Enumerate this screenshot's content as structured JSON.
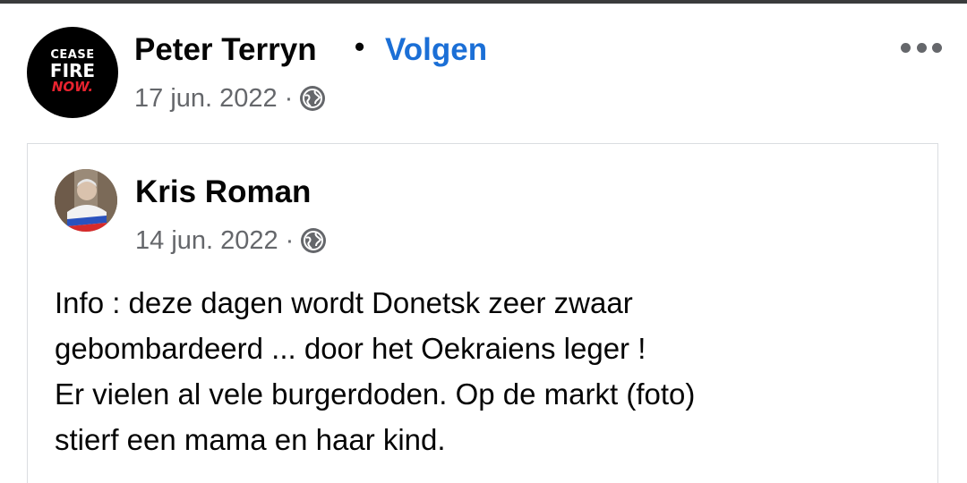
{
  "post": {
    "author": "Peter Terryn",
    "separator": "•",
    "follow_label": "Volgen",
    "date": "17 jun. 2022",
    "meta_separator": "·",
    "privacy_icon": "globe-icon",
    "menu_icon": "more-options-icon",
    "avatar": {
      "line1": "CEASE",
      "line2": "FIRE",
      "line3": "NOW."
    }
  },
  "shared": {
    "author": "Kris Roman",
    "date": "14 jun. 2022",
    "meta_separator": "·",
    "privacy_icon": "globe-icon",
    "text_lines": [
      "Info : deze dagen wordt Donetsk zeer zwaar",
      "gebombardeerd ... door het Oekraiens leger !",
      "Er vielen al vele burgerdoden. Op de markt (foto)",
      "stierf een mama en haar kind."
    ]
  },
  "colors": {
    "link": "#1b6fd6",
    "secondary_text": "#65676b",
    "primary_text": "#050505",
    "card_border": "#dadde1"
  }
}
